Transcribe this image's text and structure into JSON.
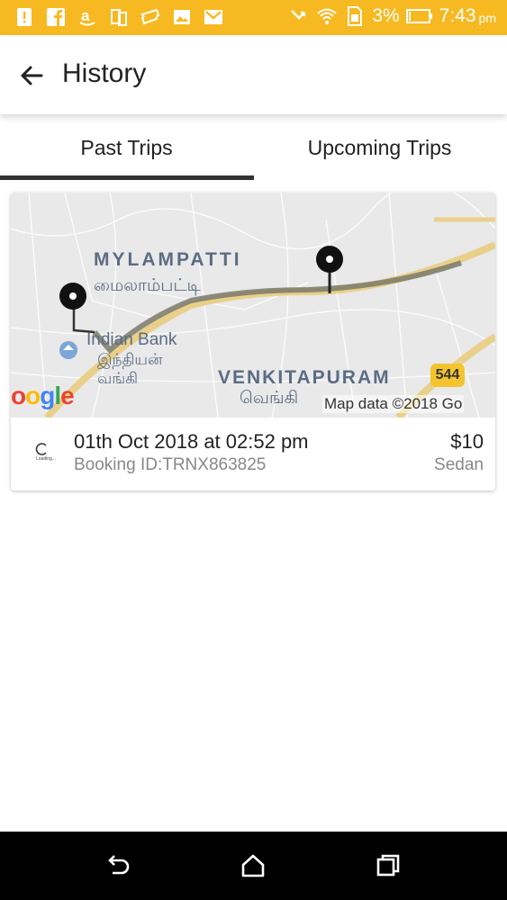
{
  "status_bar": {
    "battery_percent": "3%",
    "time": "7:43",
    "ampm": "pm",
    "background_color": "#f7b921",
    "left_icons": [
      "alert-icon",
      "facebook-icon",
      "amazon-icon",
      "sim-icon",
      "ticket-icon",
      "image-icon",
      "gmail-icon"
    ],
    "right_icons": [
      "missed-call-icon",
      "wifi-icon",
      "sim-card-icon",
      "battery-icon"
    ]
  },
  "header": {
    "title": "History",
    "back_icon": "arrow-left-icon"
  },
  "tabs": [
    {
      "label": "Past Trips",
      "active": true
    },
    {
      "label": "Upcoming Trips",
      "active": false
    }
  ],
  "trips": [
    {
      "datetime": "01th Oct 2018 at 02:52 pm",
      "booking_id": "Booking ID:TRNX863825",
      "price": "$10",
      "vehicle": "Sedan",
      "loader_text": "Loading...",
      "map": {
        "place_1": "MYLAMPATTI",
        "place_1_tamil": "மைலாம்பட்டி",
        "poi": "Indian Bank",
        "poi_tamil_1": "இந்தியன்",
        "poi_tamil_2": "வங்கி",
        "place_2": "VENKITAPURAM",
        "place_2_tamil": "வெங்கி",
        "road_number": "544",
        "google_logo": "oogle",
        "attribution": "Map data ©2018 Go"
      }
    }
  ],
  "nav_bar": {
    "icons": [
      "back-nav-icon",
      "home-nav-icon",
      "recents-nav-icon"
    ]
  }
}
